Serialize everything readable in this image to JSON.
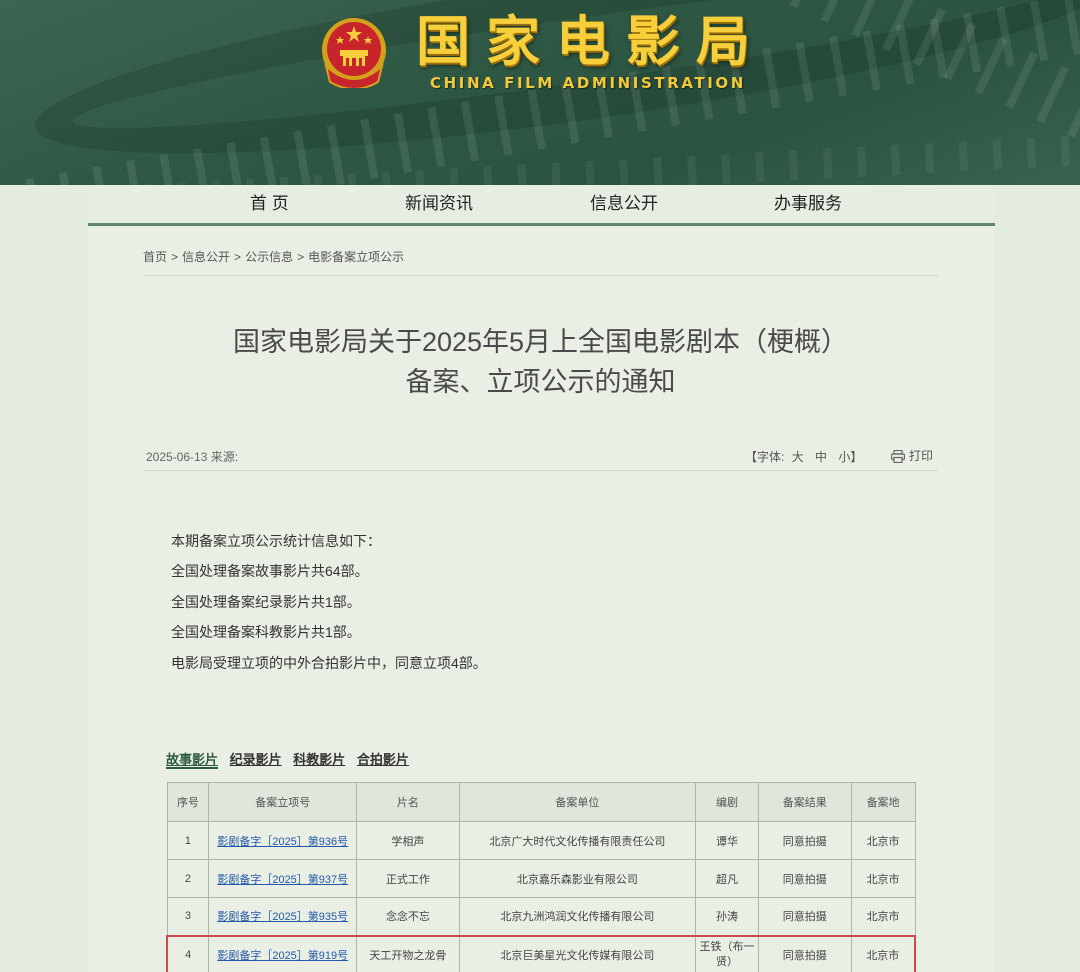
{
  "header": {
    "logo_cn": "国家电影局",
    "logo_en": "CHINA FILM ADMINISTRATION"
  },
  "nav": {
    "items": [
      {
        "label": "首 页"
      },
      {
        "label": "新闻资讯"
      },
      {
        "label": "信息公开"
      },
      {
        "label": "办事服务"
      }
    ]
  },
  "breadcrumb": {
    "items": [
      "首页",
      "信息公开",
      "公示信息",
      "电影备案立项公示"
    ],
    "separator": ">"
  },
  "article": {
    "title_line1": "国家电影局关于2025年5月上全国电影剧本（梗概）",
    "title_line2": "备案、立项公示的通知",
    "date": "2025-06-13",
    "source_label": "来源:",
    "font_label": "【字体:",
    "font_large": "大",
    "font_medium": "中",
    "font_small": "小】",
    "print_label": "打印",
    "stats": [
      "本期备案立项公示统计信息如下：",
      "全国处理备案故事影片共64部。",
      "全国处理备案纪录影片共1部。",
      "全国处理备案科教影片共1部。",
      "电影局受理立项的中外合拍影片中，同意立项4部。"
    ]
  },
  "tabs": [
    {
      "label": "故事影片",
      "active": true
    },
    {
      "label": "纪录影片",
      "active": false
    },
    {
      "label": "科教影片",
      "active": false
    },
    {
      "label": "合拍影片",
      "active": false
    }
  ],
  "table": {
    "headers": [
      "序号",
      "备案立项号",
      "片名",
      "备案单位",
      "编剧",
      "备案结果",
      "备案地"
    ],
    "rows": [
      {
        "no": "1",
        "id": "影剧备字［2025］第936号",
        "title": "学相声",
        "unit": "北京广大时代文化传播有限责任公司",
        "writer": "谭华",
        "result": "同意拍摄",
        "place": "北京市"
      },
      {
        "no": "2",
        "id": "影剧备字［2025］第937号",
        "title": "正式工作",
        "unit": "北京嘉乐森影业有限公司",
        "writer": "超凡",
        "result": "同意拍摄",
        "place": "北京市"
      },
      {
        "no": "3",
        "id": "影剧备字［2025］第935号",
        "title": "念念不忘",
        "unit": "北京九洲鸿润文化传播有限公司",
        "writer": "孙涛",
        "result": "同意拍摄",
        "place": "北京市"
      },
      {
        "no": "4",
        "id": "影剧备字［2025］第919号",
        "title": "天工开物之龙骨",
        "unit": "北京巨美星光文化传媒有限公司",
        "writer": "王铁（布一贤）",
        "result": "同意拍摄",
        "place": "北京市"
      }
    ]
  },
  "colors": {
    "header_green": "#2f5844",
    "logo_gold": "#f6cf3a",
    "nav_underline": "#5f8571",
    "link_blue": "#2459a6",
    "highlight_red": "#d0474c"
  }
}
